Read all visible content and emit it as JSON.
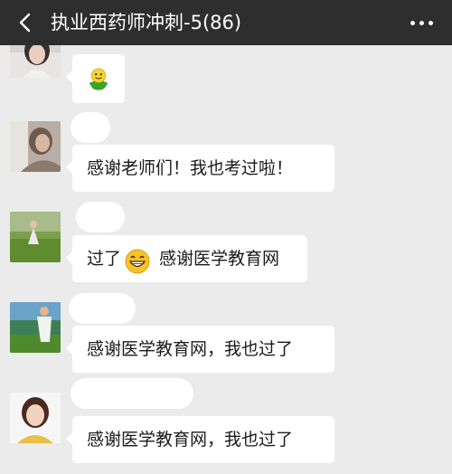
{
  "header": {
    "title": "执业西药师冲刺-5(86)",
    "back_icon": "chevron-left-icon",
    "more_icon": "more-dots-icon"
  },
  "colors": {
    "titlebar": "#2e2e2e",
    "chat_background": "#ebebeb",
    "bubble": "#ffffff",
    "text": "#1a1a1a"
  },
  "messages": [
    {
      "sticker": "green-smiley-sticker",
      "text": ""
    },
    {
      "text": "感谢老师们！我也考过啦！"
    },
    {
      "text_before": "过了",
      "emoji": "grinning-face-emoji",
      "text_after": " 感谢医学教育网"
    },
    {
      "text": "感谢医学教育网，我也过了"
    },
    {
      "text": "感谢医学教育网，我也过了"
    }
  ]
}
